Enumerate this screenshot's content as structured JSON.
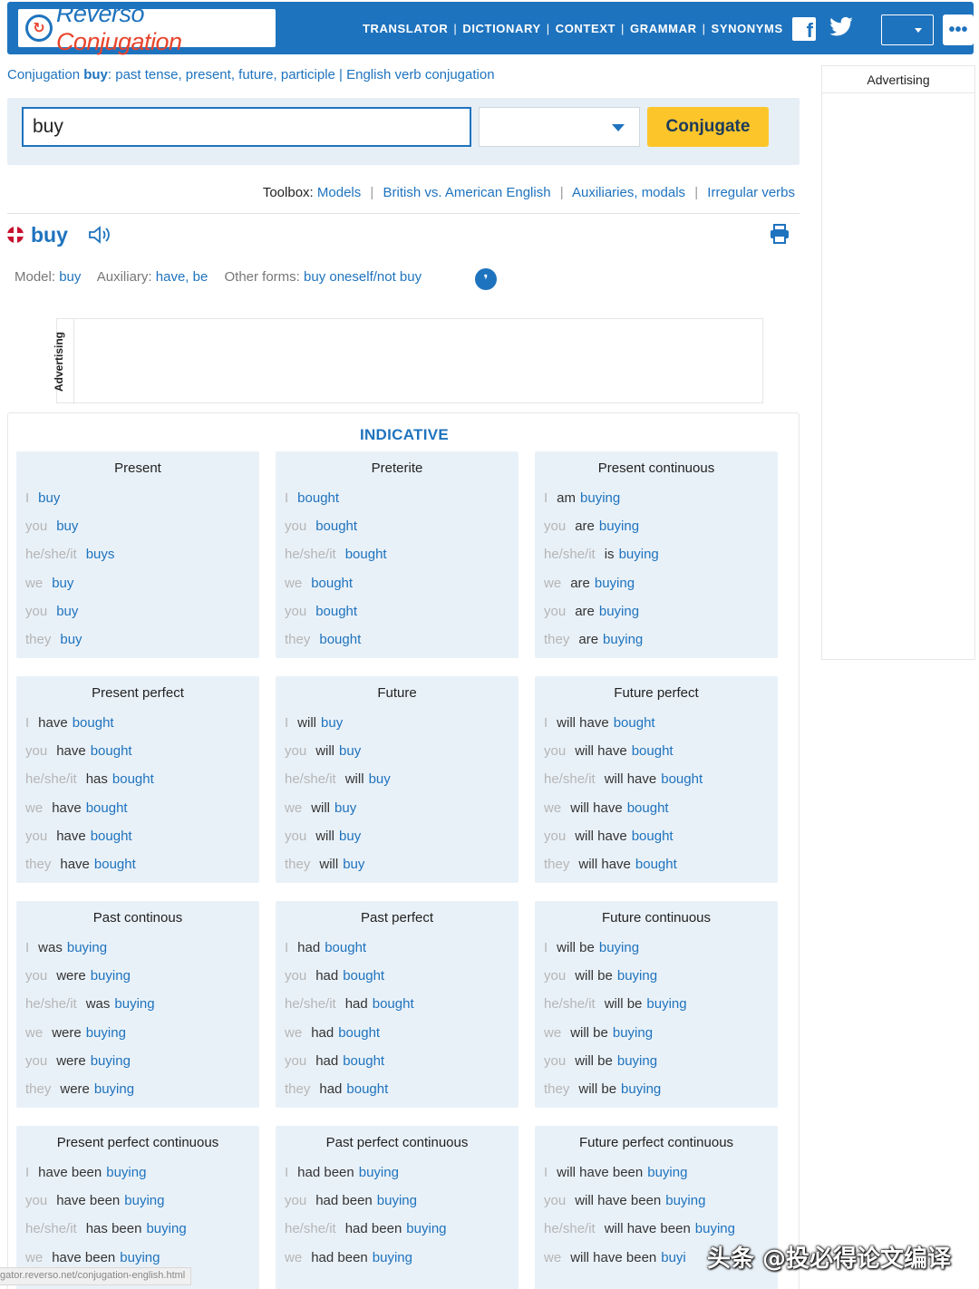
{
  "header": {
    "logo_text_a": "Reverso",
    "logo_text_b": "Conjugation",
    "nav": [
      "TRANSLATOR",
      "DICTIONARY",
      "CONTEXT",
      "GRAMMAR",
      "SYNONYMS"
    ]
  },
  "subtitle": {
    "pre": "Conjugation ",
    "verb": "buy",
    "post": ": past tense, present, future, participle | English verb conjugation"
  },
  "side_ad": {
    "label": "Advertising"
  },
  "search": {
    "value": "buy",
    "button_label": "Conjugate"
  },
  "toolbox": {
    "label": "Toolbox:",
    "links": [
      "Models",
      "British vs. American English",
      "Auxiliaries, modals",
      "Irregular verbs"
    ]
  },
  "verb": {
    "title": "buy"
  },
  "meta": {
    "model_label": "Model:",
    "model_value": "buy",
    "aux_label": "Auxiliary:",
    "aux_value": "have, be",
    "other_label": "Other forms:",
    "other_value": "buy oneself/not buy"
  },
  "ad_box": {
    "label": "Advertising"
  },
  "mood": {
    "title": "INDICATIVE"
  },
  "tenses": [
    {
      "title": "Present",
      "rows": [
        {
          "p": "I",
          "a": "",
          "v": "buy"
        },
        {
          "p": "you",
          "a": "",
          "v": "buy"
        },
        {
          "p": "he/she/it",
          "a": "",
          "v": "buys"
        },
        {
          "p": "we",
          "a": "",
          "v": "buy"
        },
        {
          "p": "you",
          "a": "",
          "v": "buy"
        },
        {
          "p": "they",
          "a": "",
          "v": "buy"
        }
      ]
    },
    {
      "title": "Preterite",
      "rows": [
        {
          "p": "I",
          "a": "",
          "v": "bought"
        },
        {
          "p": "you",
          "a": "",
          "v": "bought"
        },
        {
          "p": "he/she/it",
          "a": "",
          "v": "bought"
        },
        {
          "p": "we",
          "a": "",
          "v": "bought"
        },
        {
          "p": "you",
          "a": "",
          "v": "bought"
        },
        {
          "p": "they",
          "a": "",
          "v": "bought"
        }
      ]
    },
    {
      "title": "Present continuous",
      "rows": [
        {
          "p": "I",
          "a": "am",
          "v": "buying"
        },
        {
          "p": "you",
          "a": "are",
          "v": "buying"
        },
        {
          "p": "he/she/it",
          "a": "is",
          "v": "buying"
        },
        {
          "p": "we",
          "a": "are",
          "v": "buying"
        },
        {
          "p": "you",
          "a": "are",
          "v": "buying"
        },
        {
          "p": "they",
          "a": "are",
          "v": "buying"
        }
      ]
    },
    {
      "title": "Present perfect",
      "rows": [
        {
          "p": "I",
          "a": "have",
          "v": "bought"
        },
        {
          "p": "you",
          "a": "have",
          "v": "bought"
        },
        {
          "p": "he/she/it",
          "a": "has",
          "v": "bought"
        },
        {
          "p": "we",
          "a": "have",
          "v": "bought"
        },
        {
          "p": "you",
          "a": "have",
          "v": "bought"
        },
        {
          "p": "they",
          "a": "have",
          "v": "bought"
        }
      ]
    },
    {
      "title": "Future",
      "rows": [
        {
          "p": "I",
          "a": "will",
          "v": "buy"
        },
        {
          "p": "you",
          "a": "will",
          "v": "buy"
        },
        {
          "p": "he/she/it",
          "a": "will",
          "v": "buy"
        },
        {
          "p": "we",
          "a": "will",
          "v": "buy"
        },
        {
          "p": "you",
          "a": "will",
          "v": "buy"
        },
        {
          "p": "they",
          "a": "will",
          "v": "buy"
        }
      ]
    },
    {
      "title": "Future perfect",
      "rows": [
        {
          "p": "I",
          "a": "will have",
          "v": "bought"
        },
        {
          "p": "you",
          "a": "will have",
          "v": "bought"
        },
        {
          "p": "he/she/it",
          "a": "will have",
          "v": "bought"
        },
        {
          "p": "we",
          "a": "will have",
          "v": "bought"
        },
        {
          "p": "you",
          "a": "will have",
          "v": "bought"
        },
        {
          "p": "they",
          "a": "will have",
          "v": "bought"
        }
      ]
    },
    {
      "title": "Past continous",
      "rows": [
        {
          "p": "I",
          "a": "was",
          "v": "buying"
        },
        {
          "p": "you",
          "a": "were",
          "v": "buying"
        },
        {
          "p": "he/she/it",
          "a": "was",
          "v": "buying"
        },
        {
          "p": "we",
          "a": "were",
          "v": "buying"
        },
        {
          "p": "you",
          "a": "were",
          "v": "buying"
        },
        {
          "p": "they",
          "a": "were",
          "v": "buying"
        }
      ]
    },
    {
      "title": "Past perfect",
      "rows": [
        {
          "p": "I",
          "a": "had",
          "v": "bought"
        },
        {
          "p": "you",
          "a": "had",
          "v": "bought"
        },
        {
          "p": "he/she/it",
          "a": "had",
          "v": "bought"
        },
        {
          "p": "we",
          "a": "had",
          "v": "bought"
        },
        {
          "p": "you",
          "a": "had",
          "v": "bought"
        },
        {
          "p": "they",
          "a": "had",
          "v": "bought"
        }
      ]
    },
    {
      "title": "Future continuous",
      "rows": [
        {
          "p": "I",
          "a": "will be",
          "v": "buying"
        },
        {
          "p": "you",
          "a": "will be",
          "v": "buying"
        },
        {
          "p": "he/she/it",
          "a": "will be",
          "v": "buying"
        },
        {
          "p": "we",
          "a": "will be",
          "v": "buying"
        },
        {
          "p": "you",
          "a": "will be",
          "v": "buying"
        },
        {
          "p": "they",
          "a": "will be",
          "v": "buying"
        }
      ]
    },
    {
      "title": "Present perfect continuous",
      "rows": [
        {
          "p": "I",
          "a": "have been",
          "v": "buying"
        },
        {
          "p": "you",
          "a": "have been",
          "v": "buying"
        },
        {
          "p": "he/she/it",
          "a": "has been",
          "v": "buying"
        },
        {
          "p": "we",
          "a": "have been",
          "v": "buying"
        }
      ]
    },
    {
      "title": "Past perfect continuous",
      "rows": [
        {
          "p": "I",
          "a": "had been",
          "v": "buying"
        },
        {
          "p": "you",
          "a": "had been",
          "v": "buying"
        },
        {
          "p": "he/she/it",
          "a": "had been",
          "v": "buying"
        },
        {
          "p": "we",
          "a": "had been",
          "v": "buying"
        }
      ]
    },
    {
      "title": "Future perfect continuous",
      "rows": [
        {
          "p": "I",
          "a": "will have been",
          "v": "buying"
        },
        {
          "p": "you",
          "a": "will have been",
          "v": "buying"
        },
        {
          "p": "he/she/it",
          "a": "will have been",
          "v": "buying"
        },
        {
          "p": "we",
          "a": "will have been",
          "v": "buyi"
        }
      ]
    }
  ],
  "status_bar": {
    "url": "gator.reverso.net/conjugation-english.html"
  },
  "watermark": {
    "text": "头条 @投必得论文编译"
  },
  "colors": {
    "brand": "#1e73be",
    "accent": "#fcc52a",
    "card_bg": "#e9f1f8",
    "logo_red": "#e8442d"
  }
}
